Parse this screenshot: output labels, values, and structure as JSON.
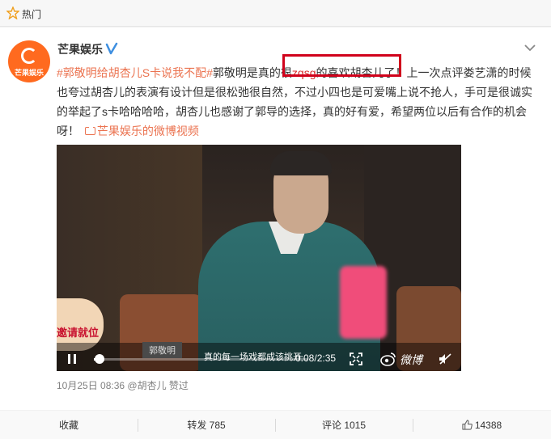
{
  "topbar": {
    "label": "热门"
  },
  "post": {
    "author": "芒果娱乐",
    "avatar_text": "芒果娱乐",
    "hashtag": "#郭敬明给胡杏儿S卡说我不配#",
    "text_1": "郭敬明是真的很",
    "text_red": "zqsg",
    "text_2": "的喜欢胡杏儿了",
    "text_3": "！上一次点评娄艺潇的时候也夸过胡杏儿的表演有设计但是很松弛很自然，不过小四也是可爱嘴上说不抢人，手可是很诚实的举起了s卡哈哈哈哈，胡杏儿也感谢了郭导的选择，真的好有爱，希望两位以后有合作的机会呀！",
    "video_link": "芒果娱乐的微博视频"
  },
  "video": {
    "logo_text": "邀请就位",
    "caption_name": "郭敬明",
    "caption_text": "真的每一场戏都成该挑开",
    "time": "0:08/2:35",
    "watermark": "微博",
    "progress": 0.05
  },
  "meta": {
    "date": "10月25日 08:36",
    "source": "@胡杏儿 赞过"
  },
  "actions": {
    "favorite": "收藏",
    "repost": "转发 785",
    "comment": "评论 1015",
    "like": "14388"
  },
  "colors": {
    "link": "#eb7350",
    "highlight": "#d0021b",
    "avatar": "#ff6a1f"
  }
}
